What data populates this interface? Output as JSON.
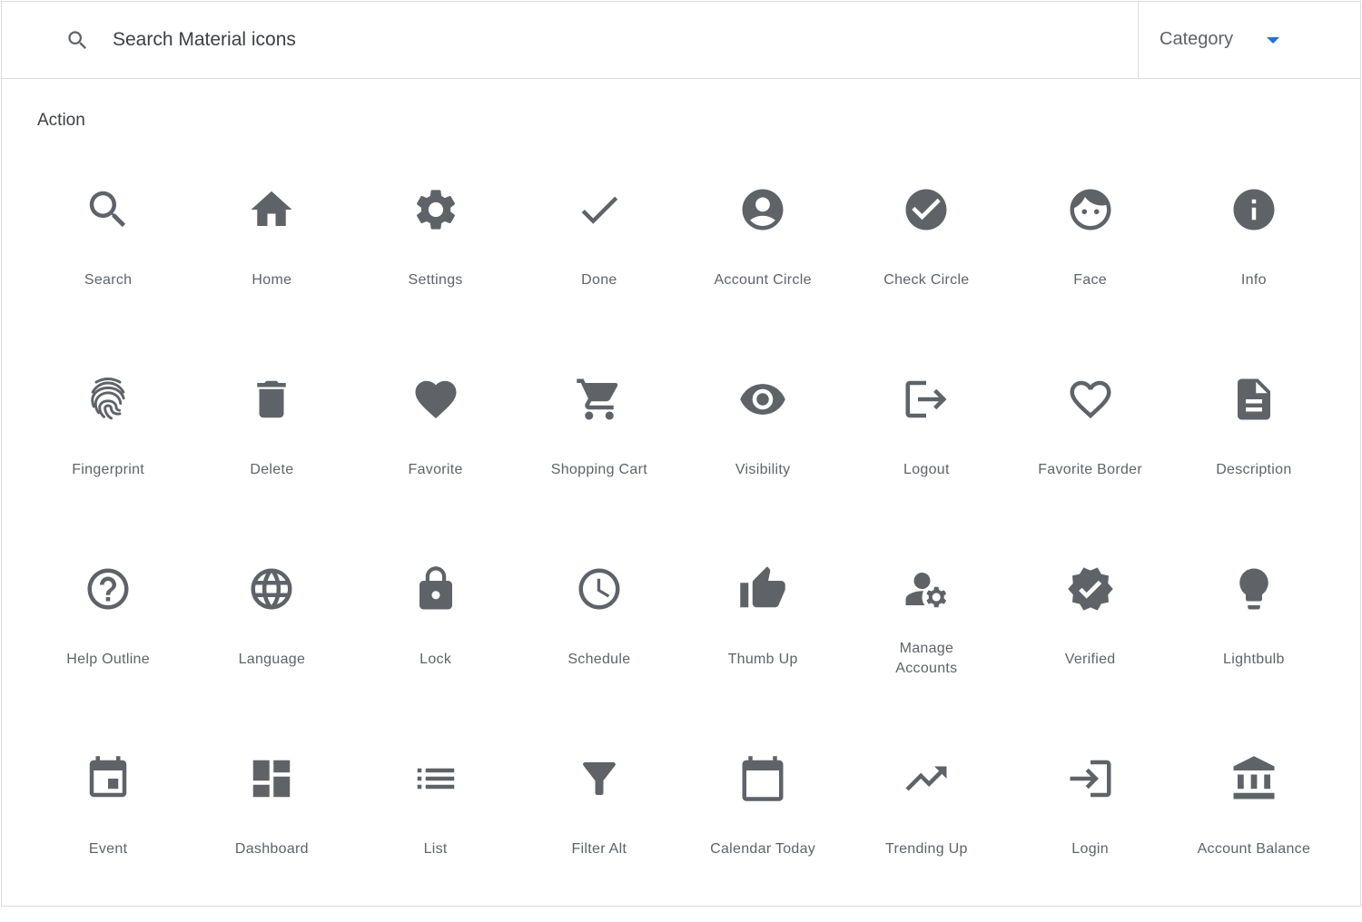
{
  "search": {
    "placeholder": "Search Material icons"
  },
  "category": {
    "label": "Category",
    "accent": "#1a73e8"
  },
  "section": {
    "title": "Action"
  },
  "icon_color": "#5f6368",
  "icons": [
    {
      "label": "Search",
      "icon": "search-icon"
    },
    {
      "label": "Home",
      "icon": "home-icon"
    },
    {
      "label": "Settings",
      "icon": "settings-icon"
    },
    {
      "label": "Done",
      "icon": "done-icon"
    },
    {
      "label": "Account Circle",
      "icon": "account-circle-icon"
    },
    {
      "label": "Check Circle",
      "icon": "check-circle-icon"
    },
    {
      "label": "Face",
      "icon": "face-icon"
    },
    {
      "label": "Info",
      "icon": "info-icon"
    },
    {
      "label": "Fingerprint",
      "icon": "fingerprint-icon"
    },
    {
      "label": "Delete",
      "icon": "delete-icon"
    },
    {
      "label": "Favorite",
      "icon": "favorite-icon"
    },
    {
      "label": "Shopping Cart",
      "icon": "shopping-cart-icon"
    },
    {
      "label": "Visibility",
      "icon": "visibility-icon"
    },
    {
      "label": "Logout",
      "icon": "logout-icon"
    },
    {
      "label": "Favorite Border",
      "icon": "favorite-border-icon"
    },
    {
      "label": "Description",
      "icon": "description-icon"
    },
    {
      "label": "Help Outline",
      "icon": "help-outline-icon"
    },
    {
      "label": "Language",
      "icon": "language-icon"
    },
    {
      "label": "Lock",
      "icon": "lock-icon"
    },
    {
      "label": "Schedule",
      "icon": "schedule-icon"
    },
    {
      "label": "Thumb Up",
      "icon": "thumb-up-icon"
    },
    {
      "label": "Manage Accounts",
      "icon": "manage-accounts-icon"
    },
    {
      "label": "Verified",
      "icon": "verified-icon"
    },
    {
      "label": "Lightbulb",
      "icon": "lightbulb-icon"
    },
    {
      "label": "Event",
      "icon": "event-icon"
    },
    {
      "label": "Dashboard",
      "icon": "dashboard-icon"
    },
    {
      "label": "List",
      "icon": "list-icon"
    },
    {
      "label": "Filter Alt",
      "icon": "filter-alt-icon"
    },
    {
      "label": "Calendar Today",
      "icon": "calendar-today-icon"
    },
    {
      "label": "Trending Up",
      "icon": "trending-up-icon"
    },
    {
      "label": "Login",
      "icon": "login-icon"
    },
    {
      "label": "Account Balance",
      "icon": "account-balance-icon"
    }
  ]
}
